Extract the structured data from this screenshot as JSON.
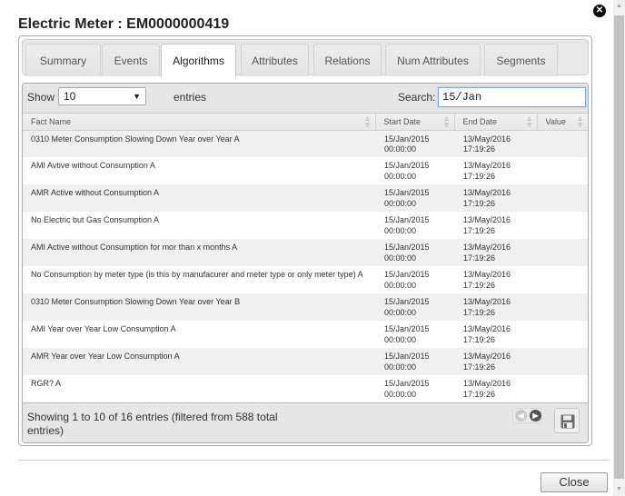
{
  "dialog": {
    "title": "Electric Meter : EM0000000419",
    "close_icon": "close-circle-icon",
    "close_button_label": "Close"
  },
  "tabs": [
    {
      "label": "Summary",
      "active": false
    },
    {
      "label": "Events",
      "active": false
    },
    {
      "label": "Algorithms",
      "active": true
    },
    {
      "label": "Attributes",
      "active": false
    },
    {
      "label": "Relations",
      "active": false
    },
    {
      "label": "Num Attributes",
      "active": false
    },
    {
      "label": "Segments",
      "active": false
    }
  ],
  "table_controls": {
    "show_label": "Show",
    "page_length": "10",
    "entries_label": "entries",
    "search_label": "Search:",
    "search_value": "15/Jan"
  },
  "table": {
    "columns": [
      "Fact Name",
      "Start Date",
      "End Date",
      "Value"
    ],
    "rows": [
      {
        "fact_name": "0310 Meter Consumption Slowing Down Year over Year A",
        "start_date": "15/Jan/2015",
        "start_time": "00:00:00",
        "end_date": "13/May/2016",
        "end_time": "17:19:26",
        "value": ""
      },
      {
        "fact_name": "AMI Avtive without Consumption A",
        "start_date": "15/Jan/2015",
        "start_time": "00:00:00",
        "end_date": "13/May/2016",
        "end_time": "17:19:26",
        "value": ""
      },
      {
        "fact_name": "AMR Active without Consumption A",
        "start_date": "15/Jan/2015",
        "start_time": "00:00:00",
        "end_date": "13/May/2016",
        "end_time": "17:19:26",
        "value": ""
      },
      {
        "fact_name": "No Electric but Gas Consumption A",
        "start_date": "15/Jan/2015",
        "start_time": "00:00:00",
        "end_date": "13/May/2016",
        "end_time": "17:19:26",
        "value": ""
      },
      {
        "fact_name": "AMI Active without Consumption for mor than x months A",
        "start_date": "15/Jan/2015",
        "start_time": "00:00:00",
        "end_date": "13/May/2016",
        "end_time": "17:19:26",
        "value": ""
      },
      {
        "fact_name": "No Consumption by meter type (is this by manufacurer and meter type or only meter type) A",
        "start_date": "15/Jan/2015",
        "start_time": "00:00:00",
        "end_date": "13/May/2016",
        "end_time": "17:19:26",
        "value": ""
      },
      {
        "fact_name": "0310 Meter Consumption Slowing Down Year over Year B",
        "start_date": "15/Jan/2015",
        "start_time": "00:00:00",
        "end_date": "13/May/2016",
        "end_time": "17:19:26",
        "value": ""
      },
      {
        "fact_name": "AMI Year over Year Low Consumption A",
        "start_date": "15/Jan/2015",
        "start_time": "00:00:00",
        "end_date": "13/May/2016",
        "end_time": "17:19:26",
        "value": ""
      },
      {
        "fact_name": "AMR Year over Year Low Consumption A",
        "start_date": "15/Jan/2015",
        "start_time": "00:00:00",
        "end_date": "13/May/2016",
        "end_time": "17:19:26",
        "value": ""
      },
      {
        "fact_name": "RGR? A",
        "start_date": "15/Jan/2015",
        "start_time": "00:00:00",
        "end_date": "13/May/2016",
        "end_time": "17:19:26",
        "value": ""
      }
    ]
  },
  "footer": {
    "info": "Showing 1 to 10 of 16 entries (filtered from 588 total entries)",
    "prev_icon": "arrow-left-circle-icon",
    "next_icon": "arrow-right-circle-icon",
    "save_icon": "floppy-disk-icon"
  },
  "colors": {
    "focus_border": "#7ea6d6",
    "row_stripe": "#f0f0f0",
    "toolbar_bg": "#e6e6e6"
  }
}
